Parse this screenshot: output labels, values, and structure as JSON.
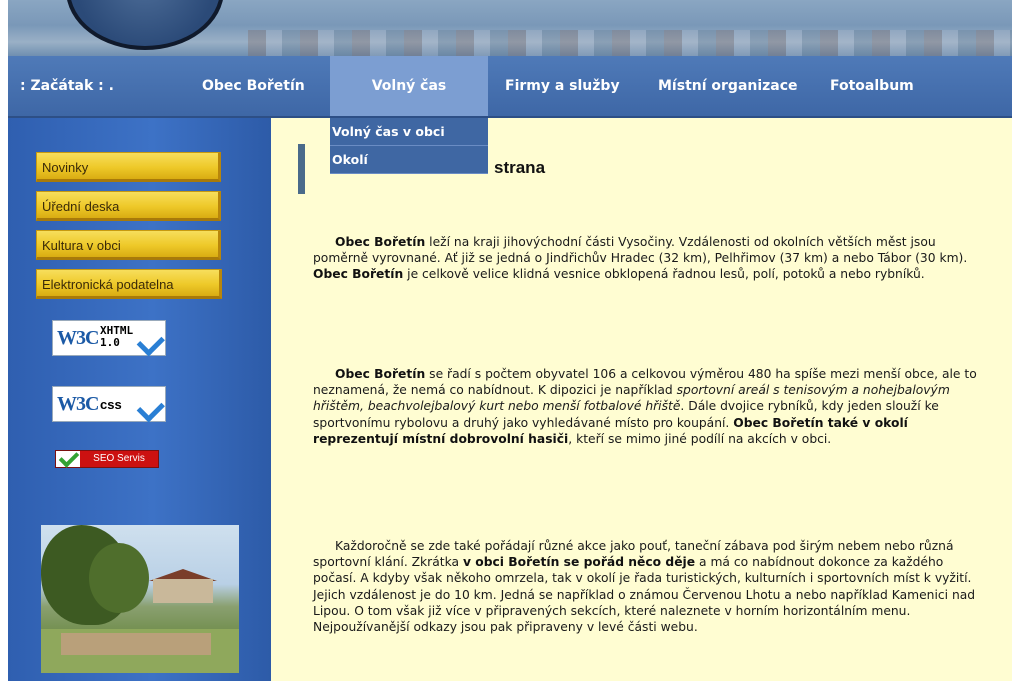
{
  "nav": {
    "items": [
      ":  Začátak  :  .",
      "Obec Bořetín",
      "Volný čas",
      "Firmy a služby",
      "Místní organizace",
      "Fotoalbum"
    ],
    "active": "Volný čas"
  },
  "dropdown": {
    "items": [
      "Volný čas v obci",
      "Okolí"
    ]
  },
  "sidebar": {
    "buttons": [
      "Novinky",
      "Úřední deska",
      "Kultura v obci",
      "Elektronická podatelna"
    ],
    "badges": {
      "xhtml_logo": "W3C",
      "xhtml_label_1": "XHTML",
      "xhtml_label_2": "1.0",
      "css_logo": "W3C",
      "css_label": "css",
      "seo_label": "SEO Servis"
    }
  },
  "main": {
    "title": "strana",
    "p1": {
      "a": "Obec Bořetín",
      "b": " leží na kraji jihovýchodní části Vysočiny. Vzdálenosti od okolních větších měst jsou poměrně vyrovnané. Ať již se jedná o Jindřichův Hradec (32 km), Pelhřimov (37 km) a nebo Tábor (30 km). ",
      "c": "Obec Bořetín",
      "d": " je celkově velice klidná vesnice obklopená řadnou lesů, polí, potoků a nebo rybníků."
    },
    "p2": {
      "a": "Obec Bořetín",
      "b": " se řadí s počtem obyvatel 106 a celkovou výměrou 480 ha spíše mezi menší obce, ale to neznamená, že nemá co nabídnout. K dipozici je například ",
      "c": "sportovní areál s tenisovým a nohejbalovým hřištěm, beachvolejbalový kurt nebo menší fotbalové hřiště",
      "d": ". Dále dvojice rybníků, kdy jeden slouží ke sportvonímu rybolovu a druhý jako vyhledávané místo pro koupání. ",
      "e": "Obec Bořetín také v okolí reprezentují místní dobrovolní hasiči",
      "f": ", kteří se mimo jiné podílí na akcích v obci."
    },
    "p3": {
      "a": "Každoročně se zde také pořádají různé akce jako pouť, taneční zábava pod širým nebem nebo různá sportovní klání. Zkrátka ",
      "b": "v obci Bořetín se pořád něco děje",
      "c": " a má co nabídnout dokonce za každého počasí. A kdyby však někoho omrzela, tak v okolí je řada turistických, kulturních i sportovních míst k vyžití. Jejich vzdálenost je do 10 km. Jedná se například o známou Červenou Lhotu a nebo například Kamenici nad Lipou. O tom však již více v připravených sekcích, které naleznete v horním horizontálním menu. Nejpoužívanější odkazy jsou pak připraveny v levé části webu."
    }
  },
  "colors": {
    "nav_bg": "#4f7ab8",
    "nav_active": "#7c9ed2",
    "sidebar_bg": "#3d72c6",
    "button_gold": "#eec929",
    "content_bg": "#fffdd2"
  }
}
